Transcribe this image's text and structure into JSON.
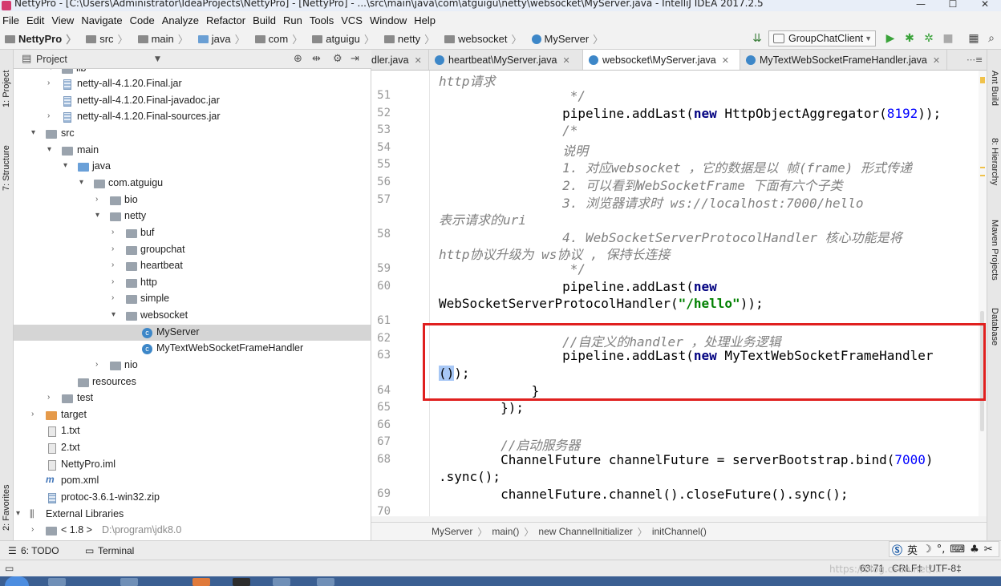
{
  "window": {
    "title": "NettyPro - [C:\\Users\\Administrator\\IdeaProjects\\NettyPro] - [NettyPro] - ...\\src\\main\\java\\com\\atguigu\\netty\\websocket\\MyServer.java - IntelliJ IDEA 2017.2.5",
    "min": "—",
    "max": "☐",
    "close": "✕"
  },
  "menu": [
    "File",
    "Edit",
    "View",
    "Navigate",
    "Code",
    "Analyze",
    "Refactor",
    "Build",
    "Run",
    "Tools",
    "VCS",
    "Window",
    "Help"
  ],
  "navbar": {
    "crumbs": [
      "NettyPro",
      "src",
      "main",
      "java",
      "com",
      "atguigu",
      "netty",
      "websocket",
      "MyServer"
    ],
    "run_config": "GroupChatClient"
  },
  "project_panel": {
    "title": "Project",
    "tree": [
      {
        "label": "lib",
        "level": 2,
        "arrow": "▾",
        "icon": "folder"
      },
      {
        "label": "netty-all-4.1.20.Final.jar",
        "level": 3,
        "arrow": "›",
        "icon": "jar"
      },
      {
        "label": "netty-all-4.1.20.Final-javadoc.jar",
        "level": 3,
        "arrow": "",
        "icon": "jar"
      },
      {
        "label": "netty-all-4.1.20.Final-sources.jar",
        "level": 3,
        "arrow": "›",
        "icon": "jar"
      },
      {
        "label": "src",
        "level": 1,
        "arrow": "▾",
        "icon": "folder"
      },
      {
        "label": "main",
        "level": 2,
        "arrow": "▾",
        "icon": "folder"
      },
      {
        "label": "java",
        "level": 3,
        "arrow": "▾",
        "icon": "folder-blue"
      },
      {
        "label": "com.atguigu",
        "level": 4,
        "arrow": "▾",
        "icon": "folder"
      },
      {
        "label": "bio",
        "level": 5,
        "arrow": "›",
        "icon": "folder"
      },
      {
        "label": "netty",
        "level": 5,
        "arrow": "▾",
        "icon": "folder"
      },
      {
        "label": "buf",
        "level": 6,
        "arrow": "›",
        "icon": "folder"
      },
      {
        "label": "groupchat",
        "level": 6,
        "arrow": "›",
        "icon": "folder"
      },
      {
        "label": "heartbeat",
        "level": 6,
        "arrow": "›",
        "icon": "folder"
      },
      {
        "label": "http",
        "level": 6,
        "arrow": "›",
        "icon": "folder"
      },
      {
        "label": "simple",
        "level": 6,
        "arrow": "›",
        "icon": "folder"
      },
      {
        "label": "websocket",
        "level": 6,
        "arrow": "▾",
        "icon": "folder"
      },
      {
        "label": "MyServer",
        "level": 7,
        "arrow": "",
        "icon": "class",
        "selected": true
      },
      {
        "label": "MyTextWebSocketFrameHandler",
        "level": 7,
        "arrow": "",
        "icon": "class"
      },
      {
        "label": "nio",
        "level": 5,
        "arrow": "›",
        "icon": "folder"
      },
      {
        "label": "resources",
        "level": 3,
        "arrow": "",
        "icon": "folder"
      },
      {
        "label": "test",
        "level": 2,
        "arrow": "›",
        "icon": "folder"
      },
      {
        "label": "target",
        "level": 1,
        "arrow": "›",
        "icon": "folder-orange"
      },
      {
        "label": "1.txt",
        "level": 1,
        "arrow": "",
        "icon": "file"
      },
      {
        "label": "2.txt",
        "level": 1,
        "arrow": "",
        "icon": "file"
      },
      {
        "label": "NettyPro.iml",
        "level": 1,
        "arrow": "",
        "icon": "file"
      },
      {
        "label": "pom.xml",
        "level": 1,
        "arrow": "",
        "icon": "maven"
      },
      {
        "label": "protoc-3.6.1-win32.zip",
        "level": 1,
        "arrow": "",
        "icon": "jar"
      },
      {
        "label": "External Libraries",
        "level": 0,
        "arrow": "▾",
        "icon": "libs"
      },
      {
        "label": "< 1.8 >",
        "level": 1,
        "arrow": "›",
        "icon": "folder",
        "extra": "D:\\program\\jdk8.0"
      }
    ]
  },
  "tabs": [
    {
      "label": "dler.java",
      "close": "✕"
    },
    {
      "label": "heartbeat\\MyServer.java",
      "close": "✕"
    },
    {
      "label": "websocket\\MyServer.java",
      "close": "✕",
      "active": true
    },
    {
      "label": "MyTextWebSocketFrameHandler.java",
      "close": "✕"
    }
  ],
  "code": [
    {
      "ln": "",
      "text": "http请求"
    },
    {
      "ln": "51",
      "text": "                 */"
    },
    {
      "ln": "52",
      "text": "                pipeline.addLast(new HttpObjectAggregator(8192));"
    },
    {
      "ln": "53",
      "text": "                /*"
    },
    {
      "ln": "54",
      "text": "                说明"
    },
    {
      "ln": "55",
      "text": "                1. 对应websocket ，它的数据是以 帧(frame) 形式传递"
    },
    {
      "ln": "56",
      "text": "                2. 可以看到WebSocketFrame 下面有六个子类"
    },
    {
      "ln": "57",
      "text": "                3. 浏览器请求时 ws://localhost:7000/hello"
    },
    {
      "ln": "",
      "text": "表示请求的uri"
    },
    {
      "ln": "58",
      "text": "                4. WebSocketServerProtocolHandler 核心功能是将"
    },
    {
      "ln": "",
      "text": "http协议升级为 ws协议 , 保持长连接"
    },
    {
      "ln": "59",
      "text": "                 */"
    },
    {
      "ln": "60",
      "text": "                pipeline.addLast(new"
    },
    {
      "ln": "",
      "text": "WebSocketServerProtocolHandler(\"/hello\"));"
    },
    {
      "ln": "61",
      "text": ""
    },
    {
      "ln": "62",
      "text": "                //自定义的handler ，处理业务逻辑"
    },
    {
      "ln": "63",
      "text": "                pipeline.addLast(new MyTextWebSocketFrameHandler"
    },
    {
      "ln": "",
      "text": "());"
    },
    {
      "ln": "64",
      "text": "            }"
    },
    {
      "ln": "65",
      "text": "        });"
    },
    {
      "ln": "66",
      "text": ""
    },
    {
      "ln": "67",
      "text": "        //启动服务器"
    },
    {
      "ln": "68",
      "text": "        ChannelFuture channelFuture = serverBootstrap.bind(7000)"
    },
    {
      "ln": "",
      "text": ".sync();"
    },
    {
      "ln": "69",
      "text": "        channelFuture.channel().closeFuture().sync();"
    },
    {
      "ln": "70",
      "text": ""
    }
  ],
  "editor_breadcrumbs": [
    "MyServer",
    "main()",
    "new ChannelInitializer",
    "initChannel()"
  ],
  "tool_windows": {
    "left": [
      "1: Project",
      "7: Structure",
      "2: Favorites"
    ],
    "right": [
      "Ant Build",
      "8: Hierarchy",
      "Maven Projects",
      "Database"
    ],
    "bottom": [
      "6: TODO",
      "Terminal"
    ]
  },
  "status": {
    "position": "63:71",
    "line_sep": "CRLF‡",
    "encoding": "UTF-8‡"
  },
  "ime": {
    "lang": "英"
  },
  "watermark": "https://blog.csdn.net/..."
}
